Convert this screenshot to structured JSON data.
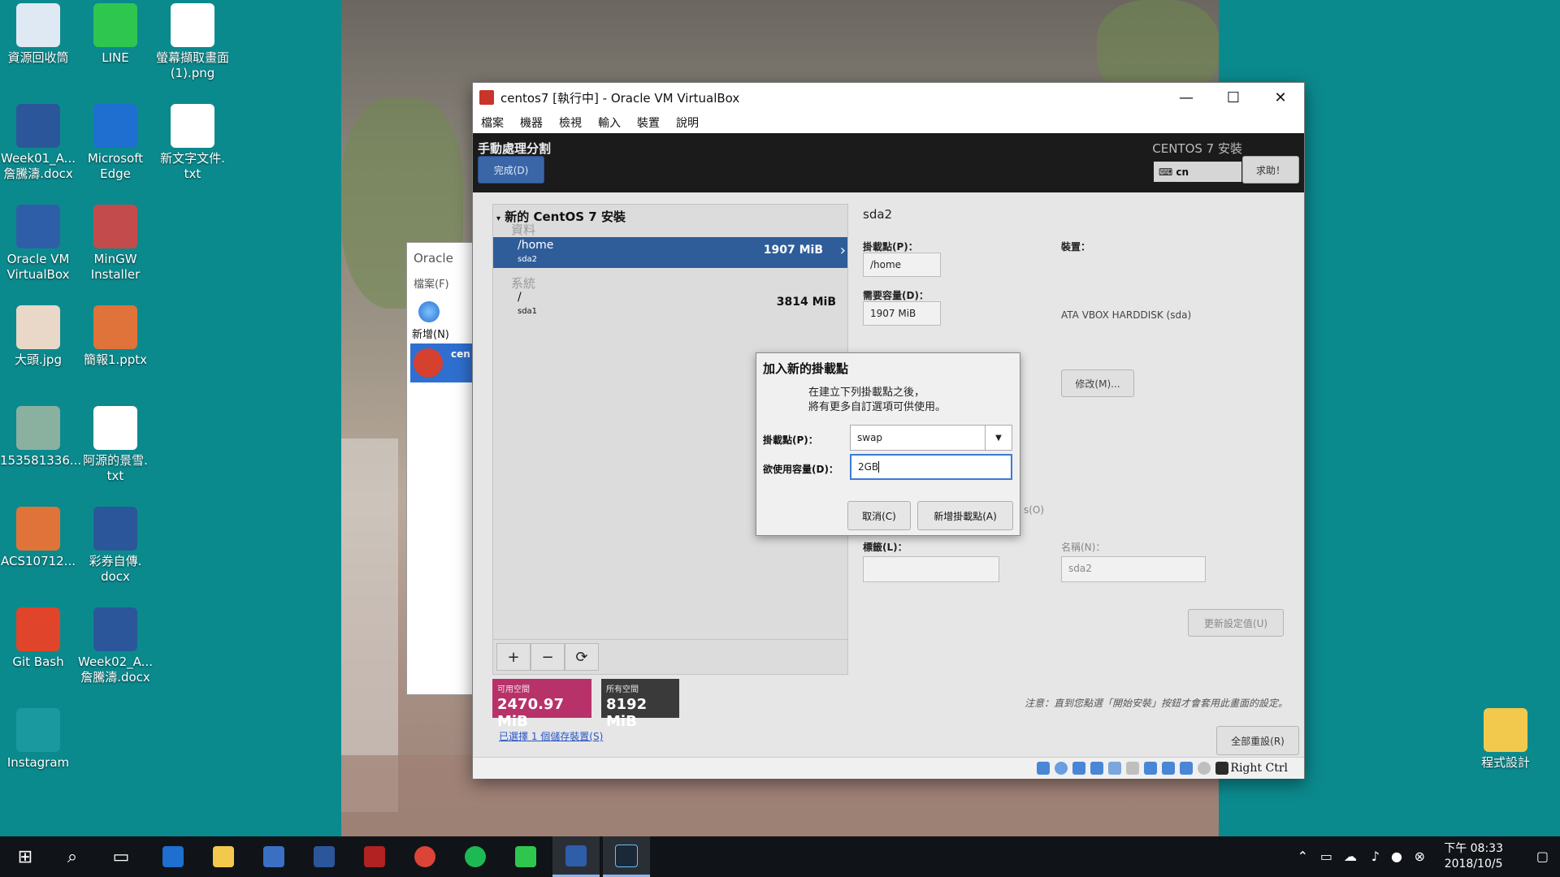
{
  "desktop": {
    "icons": [
      {
        "label": "資源回收筒",
        "icon": "recycle-bin-icon",
        "color": "#dfe9f3"
      },
      {
        "label": "LINE",
        "icon": "line-app-icon",
        "color": "#2fc650"
      },
      {
        "label": "螢幕擷取畫面\n(1).png",
        "icon": "image-file-icon",
        "color": "#ffffff"
      },
      {
        "label": "Week01_A...\n詹騰濤.docx",
        "icon": "word-doc-icon",
        "color": "#2b579a"
      },
      {
        "label": "Microsoft\nEdge",
        "icon": "edge-browser-icon",
        "color": "#1e6fd0"
      },
      {
        "label": "新文字文件.\ntxt",
        "icon": "text-file-icon",
        "color": "#ffffff"
      },
      {
        "label": "Oracle VM\nVirtualBox",
        "icon": "virtualbox-icon",
        "color": "#2f5ea8"
      },
      {
        "label": "MinGW\nInstaller",
        "icon": "mingw-installer-icon",
        "color": "#c44b4b"
      },
      {
        "label": "大頭.jpg",
        "icon": "portrait-photo-icon",
        "color": "#e9d8c8"
      },
      {
        "label": "簡報1.pptx",
        "icon": "powerpoint-file-icon",
        "color": "#e0733a"
      },
      {
        "label": "153581336...",
        "icon": "photo-file-icon",
        "color": "#8ab0a0"
      },
      {
        "label": "阿源的景雪.\ntxt",
        "icon": "text-file-icon",
        "color": "#ffffff"
      },
      {
        "label": "ACS10712...",
        "icon": "powerpoint-file-icon",
        "color": "#e0733a"
      },
      {
        "label": "彩券自傳.\ndocx",
        "icon": "word-doc-icon",
        "color": "#2b579a"
      },
      {
        "label": "Git Bash",
        "icon": "git-bash-icon",
        "color": "#e0442a"
      },
      {
        "label": "Week02_A...\n詹騰濤.docx",
        "icon": "word-doc-icon",
        "color": "#2b579a"
      },
      {
        "label": "Instagram",
        "icon": "instagram-icon",
        "color": "#1a9a9e"
      },
      {
        "label": "程式設計",
        "icon": "folder-icon",
        "color": "#f2c94c"
      }
    ]
  },
  "bg_manager": {
    "title": "Oracle",
    "menu": "檔案(F)",
    "new_label": "新增(N)",
    "vm_label": "cen"
  },
  "vmwindow": {
    "title": "centos7 [執行中] - Oracle VM VirtualBox",
    "menu": [
      "檔案",
      "機器",
      "檢視",
      "輸入",
      "裝置",
      "說明"
    ]
  },
  "guest": {
    "header_title": "手動處理分割",
    "done_button": "完成(D)",
    "install_title": "CENTOS 7 安裝",
    "keyboard": "cn",
    "help_button": "求助！",
    "tree_title": "新的 CentOS 7 安裝",
    "group_data": "資料",
    "group_system": "系統",
    "partitions": [
      {
        "mount": "/home",
        "device": "sda2",
        "size": "1907 MiB"
      },
      {
        "mount": "/",
        "device": "sda1",
        "size": "3814 MiB"
      }
    ],
    "tools": [
      "+",
      "−",
      "⟳"
    ],
    "available_label": "可用空間",
    "available_value": "2470.97 MiB",
    "total_label": "所有空間",
    "total_value": "8192 MiB",
    "storage_link": "已選擇 1 個儲存裝置(S)",
    "detail": {
      "title": "sda2",
      "mount_label": "掛載點(P)：",
      "mount_value": "/home",
      "capacity_label": "需要容量(D)：",
      "capacity_value": "1907 MiB",
      "device_label": "裝置：",
      "device_value": "ATA VBOX HARDDISK (sda)",
      "modify_button": "修改(M)...",
      "partial_text": "s(O)",
      "tag_label": "標籤(L)：",
      "name_label": "名稱(N)：",
      "name_value": "sda2",
      "update_button": "更新設定值(U)",
      "note": "注意：直到您點選「開始安裝」按鈕才會套用此畫面的設定。",
      "reset_all": "全部重設(R)"
    },
    "colors": {
      "available": "#b8326a",
      "total": "#3a3a3a",
      "selected_row": "#2e5d9a"
    }
  },
  "dialog": {
    "title": "加入新的掛載點",
    "desc_line1": "在建立下列掛載點之後，",
    "desc_line2": "將有更多自訂選項可供使用。",
    "mount_label": "掛載點(P)：",
    "mount_value": "swap",
    "capacity_label": "欲使用容量(D)：",
    "capacity_value": "2GB",
    "cancel_button": "取消(C)",
    "add_button": "新增掛載點(A)"
  },
  "statusbar": {
    "host_key": "Right Ctrl"
  },
  "taskbar": {
    "time": "下午 08:33",
    "date": "2018/10/5"
  }
}
